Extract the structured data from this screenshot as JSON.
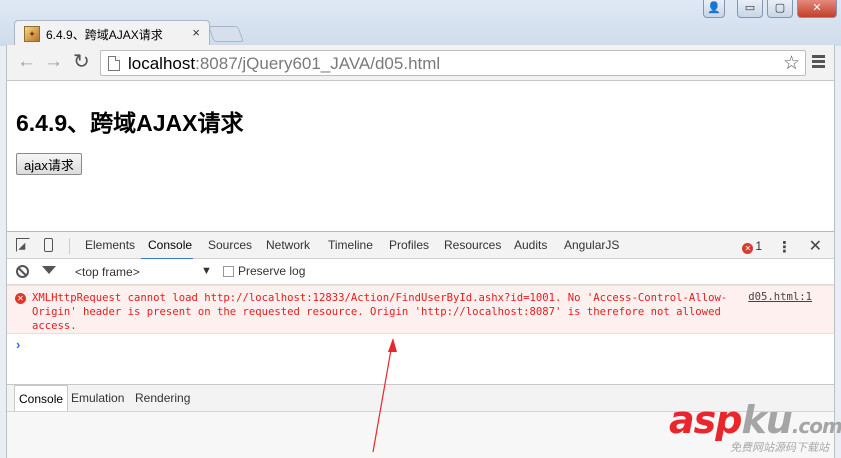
{
  "window": {
    "tab_title": "6.4.9、跨域AJAX请求",
    "tab_close": "×",
    "controls": {
      "user": "👤",
      "minimize": "▭",
      "maximize": "▢",
      "close": "✕"
    }
  },
  "toolbar": {
    "back": "←",
    "forward": "→",
    "reload": "↻",
    "url_host": "localhost",
    "url_rest": ":8087/jQuery601_JAVA/d05.html",
    "star": "☆"
  },
  "page": {
    "heading": "6.4.9、跨域AJAX请求",
    "button_label": "ajax请求"
  },
  "devtools": {
    "tabs": [
      "Elements",
      "Console",
      "Sources",
      "Network",
      "Timeline",
      "Profiles",
      "Resources",
      "Audits",
      "AngularJS"
    ],
    "active_tab": "Console",
    "error_count": "1",
    "menu": "⋮",
    "close": "✕",
    "console": {
      "frame": "<top frame>",
      "frame_arrow": "▼",
      "preserve_log": "Preserve log",
      "error_message": "XMLHttpRequest cannot load http://localhost:12833/Action/FindUserById.ashx?id=1001. No 'Access-Control-Allow-Origin' header is present on the requested resource. Origin 'http://localhost:8087' is therefore not allowed access.",
      "error_source": "d05.html:1",
      "prompt": "›"
    },
    "drawer_tabs": [
      "Console",
      "Emulation",
      "Rendering"
    ]
  },
  "watermark": {
    "brand_red": "asp",
    "brand_gray": "ku",
    "brand_tld": ".com",
    "subtitle": "免费网站源码下载站"
  },
  "colors": {
    "error": "#e41d1d",
    "accent": "#3879d9",
    "annotation": "#e8262b"
  }
}
